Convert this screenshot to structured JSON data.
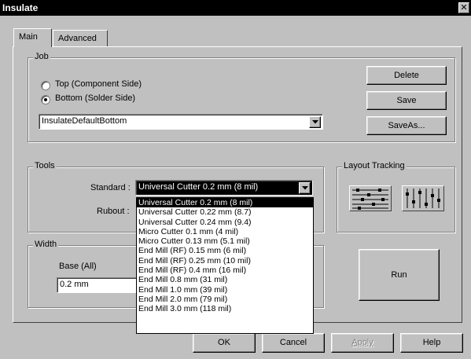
{
  "window": {
    "title": "Insulate",
    "close": "✕"
  },
  "tabs": [
    {
      "label": "Main"
    },
    {
      "label": "Advanced"
    }
  ],
  "job": {
    "label": "Job",
    "radios": [
      {
        "label": "Top (Component Side)",
        "checked": false
      },
      {
        "label": "Bottom (Solder Side)",
        "checked": true
      }
    ],
    "preset": "InsulateDefaultBottom",
    "delete": "Delete",
    "save": "Save",
    "save_as": "SaveAs..."
  },
  "tools": {
    "label": "Tools",
    "standard_label": "Standard :",
    "standard_value": "Universal Cutter 0.2 mm (8 mil)",
    "rubout_label": "Rubout :",
    "options": [
      "Universal Cutter 0.2 mm (8 mil)",
      "Universal Cutter 0.22 mm (8.7)",
      "Universal Cutter 0.24 mm (9.4)",
      "Micro Cutter 0.1 mm (4 mil)",
      "Micro Cutter 0.13 mm (5.1 mil)",
      "End Mill (RF) 0.15 mm (6 mil)",
      "End Mill (RF) 0.25 mm (10 mil)",
      "End Mill (RF) 0.4 mm (16 mil)",
      "End Mill 0.8 mm (31 mil)",
      "End Mill 1.0 mm (39 mil)",
      "End Mill 2.0 mm (79 mil)",
      "End Mill 3.0 mm (118 mil)"
    ],
    "selected_index": 0
  },
  "layout_tracking": {
    "label": "Layout Tracking",
    "icons": [
      "horizontal-tracks-icon",
      "vertical-tracks-icon"
    ]
  },
  "width": {
    "label": "Width",
    "base_label": "Base (All)",
    "base_value": "0.2 mm"
  },
  "run": "Run",
  "footer": {
    "ok": "OK",
    "cancel": "Cancel",
    "apply": "Apply",
    "help": "Help"
  }
}
